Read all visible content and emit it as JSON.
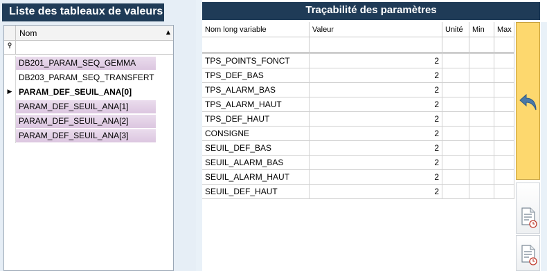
{
  "left_panel": {
    "title": "Liste des tableaux de valeurs",
    "column_header": "Nom",
    "rows": [
      {
        "name": "DB201_PARAM_SEQ_GEMMA",
        "style": "pink"
      },
      {
        "name": "DB203_PARAM_SEQ_TRANSFERT",
        "style": "plain"
      },
      {
        "name": "PARAM_DEF_SEUIL_ANA[0]",
        "style": "selected"
      },
      {
        "name": "PARAM_DEF_SEUIL_ANA[1]",
        "style": "pink"
      },
      {
        "name": "PARAM_DEF_SEUIL_ANA[2]",
        "style": "pink"
      },
      {
        "name": "PARAM_DEF_SEUIL_ANA[3]",
        "style": "pink"
      }
    ],
    "filter_icon": "filter-pin-icon",
    "current_row_icon": "row-pointer-icon",
    "sort_icon": "sort-ascending-icon"
  },
  "right_panel": {
    "title": "Traçabilité des paramètres",
    "columns": {
      "name": "Nom long variable",
      "value": "Valeur",
      "unit": "Unité",
      "min": "Min",
      "max": "Max"
    },
    "rows": [
      {
        "name": "TPS_POINTS_FONCT",
        "value": "2"
      },
      {
        "name": "TPS_DEF_BAS",
        "value": "2"
      },
      {
        "name": "TPS_ALARM_BAS",
        "value": "2"
      },
      {
        "name": "TPS_ALARM_HAUT",
        "value": "2"
      },
      {
        "name": "TPS_DEF_HAUT",
        "value": "2"
      },
      {
        "name": "CONSIGNE",
        "value": "2"
      },
      {
        "name": "SEUIL_DEF_BAS",
        "value": "2"
      },
      {
        "name": "SEUIL_ALARM_BAS",
        "value": "2"
      },
      {
        "name": "SEUIL_ALARM_HAUT",
        "value": "2"
      },
      {
        "name": "SEUIL_DEF_HAUT",
        "value": "2"
      }
    ]
  },
  "side_buttons": {
    "back_icon": "back-arrow-icon",
    "history_icon_1": "document-history-icon",
    "history_icon_2": "document-history-icon",
    "back_color": "#fdd86e"
  },
  "colors": {
    "header_bg": "#1f3b57",
    "selected_row_bg": "#dcc6e0",
    "panel_bg": "#e6eef6"
  }
}
